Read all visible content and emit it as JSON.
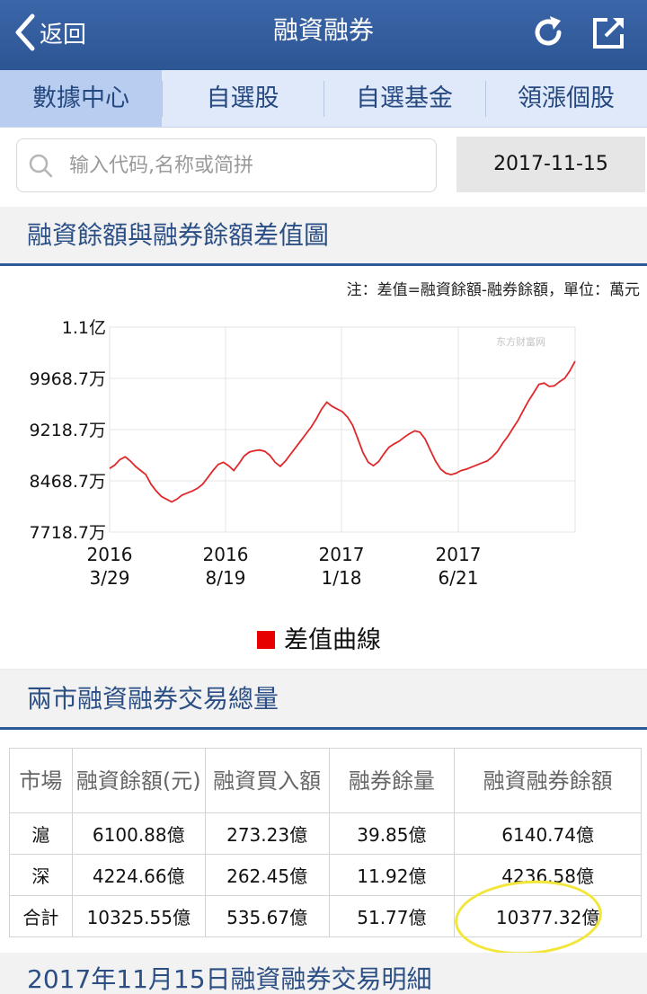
{
  "header": {
    "back_label": "返回",
    "title": "融資融券"
  },
  "tabs": [
    {
      "label": "數據中心",
      "active": true
    },
    {
      "label": "自選股"
    },
    {
      "label": "自選基金"
    },
    {
      "label": "領漲個股"
    }
  ],
  "search": {
    "placeholder": "输入代码,名称或简拼",
    "date": "2017-11-15"
  },
  "chart_section": {
    "title": "融資餘額與融券餘額差值圖",
    "note": "注：差值=融資餘額-融券餘額，單位：萬元",
    "watermark": "东方财富网",
    "accent_color": "#e0282a"
  },
  "chart_data": {
    "type": "line",
    "yticks": [
      "1.1亿",
      "9968.7万",
      "9218.7万",
      "8468.7万",
      "7718.7万"
    ],
    "ytick_values": [
      10718.7,
      9968.7,
      9218.7,
      8468.7,
      7718.7
    ],
    "ylim": [
      7718.7,
      10718.7
    ],
    "xticks": [
      {
        "line1": "2016",
        "line2": "3/29"
      },
      {
        "line1": "2016",
        "line2": "8/19"
      },
      {
        "line1": "2017",
        "line2": "1/18"
      },
      {
        "line1": "2017",
        "line2": "6/21"
      }
    ],
    "series": [
      {
        "name": "差值曲線",
        "color": "#e0282a",
        "values": [
          8650,
          8700,
          8780,
          8820,
          8760,
          8680,
          8620,
          8560,
          8420,
          8320,
          8240,
          8200,
          8160,
          8200,
          8260,
          8290,
          8320,
          8360,
          8420,
          8520,
          8620,
          8710,
          8740,
          8690,
          8620,
          8720,
          8830,
          8890,
          8910,
          8920,
          8900,
          8840,
          8740,
          8680,
          8760,
          8860,
          8960,
          9060,
          9160,
          9260,
          9380,
          9520,
          9620,
          9560,
          9520,
          9480,
          9400,
          9280,
          9080,
          8880,
          8740,
          8690,
          8750,
          8860,
          8960,
          9010,
          9050,
          9110,
          9160,
          9200,
          9180,
          9080,
          8920,
          8760,
          8640,
          8580,
          8560,
          8580,
          8620,
          8640,
          8670,
          8700,
          8730,
          8760,
          8820,
          8900,
          9020,
          9120,
          9240,
          9360,
          9500,
          9640,
          9760,
          9880,
          9900,
          9850,
          9860,
          9920,
          9970,
          10080,
          10220
        ]
      }
    ]
  },
  "totals_section": {
    "title": "兩市融資融券交易總量",
    "headers": [
      "市場",
      "融資餘額(元)",
      "融資買入額",
      "融券餘量",
      "融資融券餘額"
    ],
    "rows": [
      [
        "滬",
        "6100.88億",
        "273.23億",
        "39.85億",
        "6140.74億"
      ],
      [
        "深",
        "4224.66億",
        "262.45億",
        "11.92億",
        "4236.58億"
      ],
      [
        "合計",
        "10325.55億",
        "535.67億",
        "51.77億",
        "10377.32億"
      ]
    ]
  },
  "detail_section": {
    "title": "2017年11月15日融資融券交易明細"
  }
}
